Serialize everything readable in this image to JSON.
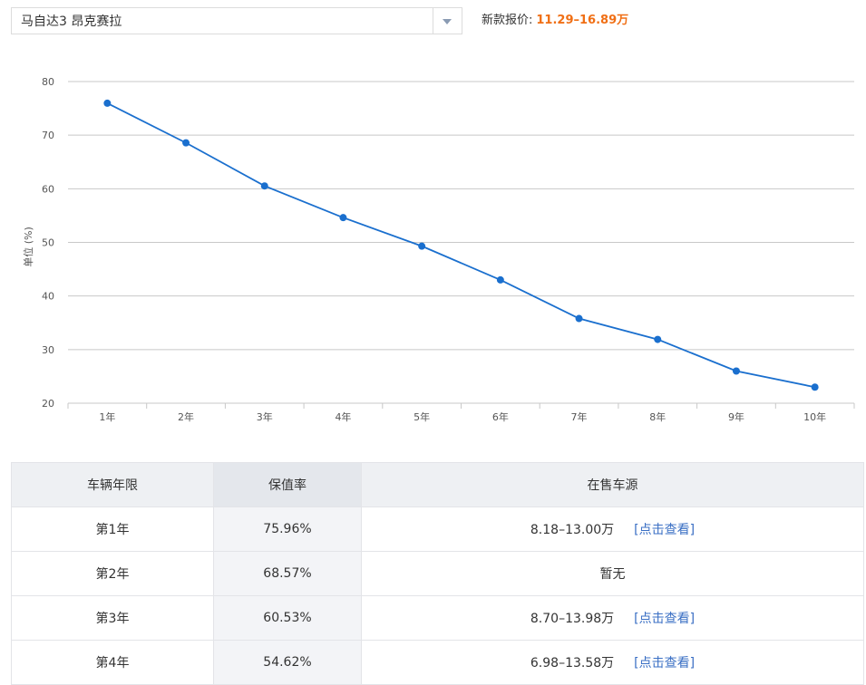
{
  "selector": {
    "model": "马自达3 昂克赛拉"
  },
  "price": {
    "label": "新款报价:",
    "value": "11.29–16.89万"
  },
  "chart_data": {
    "type": "line",
    "categories": [
      "1年",
      "2年",
      "3年",
      "4年",
      "5年",
      "6年",
      "7年",
      "8年",
      "9年",
      "10年"
    ],
    "values": [
      75.96,
      68.57,
      60.53,
      54.62,
      49.3,
      43.0,
      35.8,
      31.9,
      26.0,
      23.0
    ],
    "ylabel": "单位 (%)",
    "ylim": [
      20,
      80
    ],
    "yticks": [
      20,
      30,
      40,
      50,
      60,
      70,
      80
    ],
    "grid": true,
    "color": "#1a6fce"
  },
  "table": {
    "headers": [
      "车辆年限",
      "保值率",
      "在售车源"
    ],
    "rows": [
      {
        "year": "第1年",
        "rate": "75.96%",
        "source": "8.18–13.00万",
        "link": "[点击查看]"
      },
      {
        "year": "第2年",
        "rate": "68.57%",
        "source": "暂无",
        "link": ""
      },
      {
        "year": "第3年",
        "rate": "60.53%",
        "source": "8.70–13.98万",
        "link": "[点击查看]"
      },
      {
        "year": "第4年",
        "rate": "54.62%",
        "source": "6.98–13.58万",
        "link": "[点击查看]"
      }
    ]
  }
}
